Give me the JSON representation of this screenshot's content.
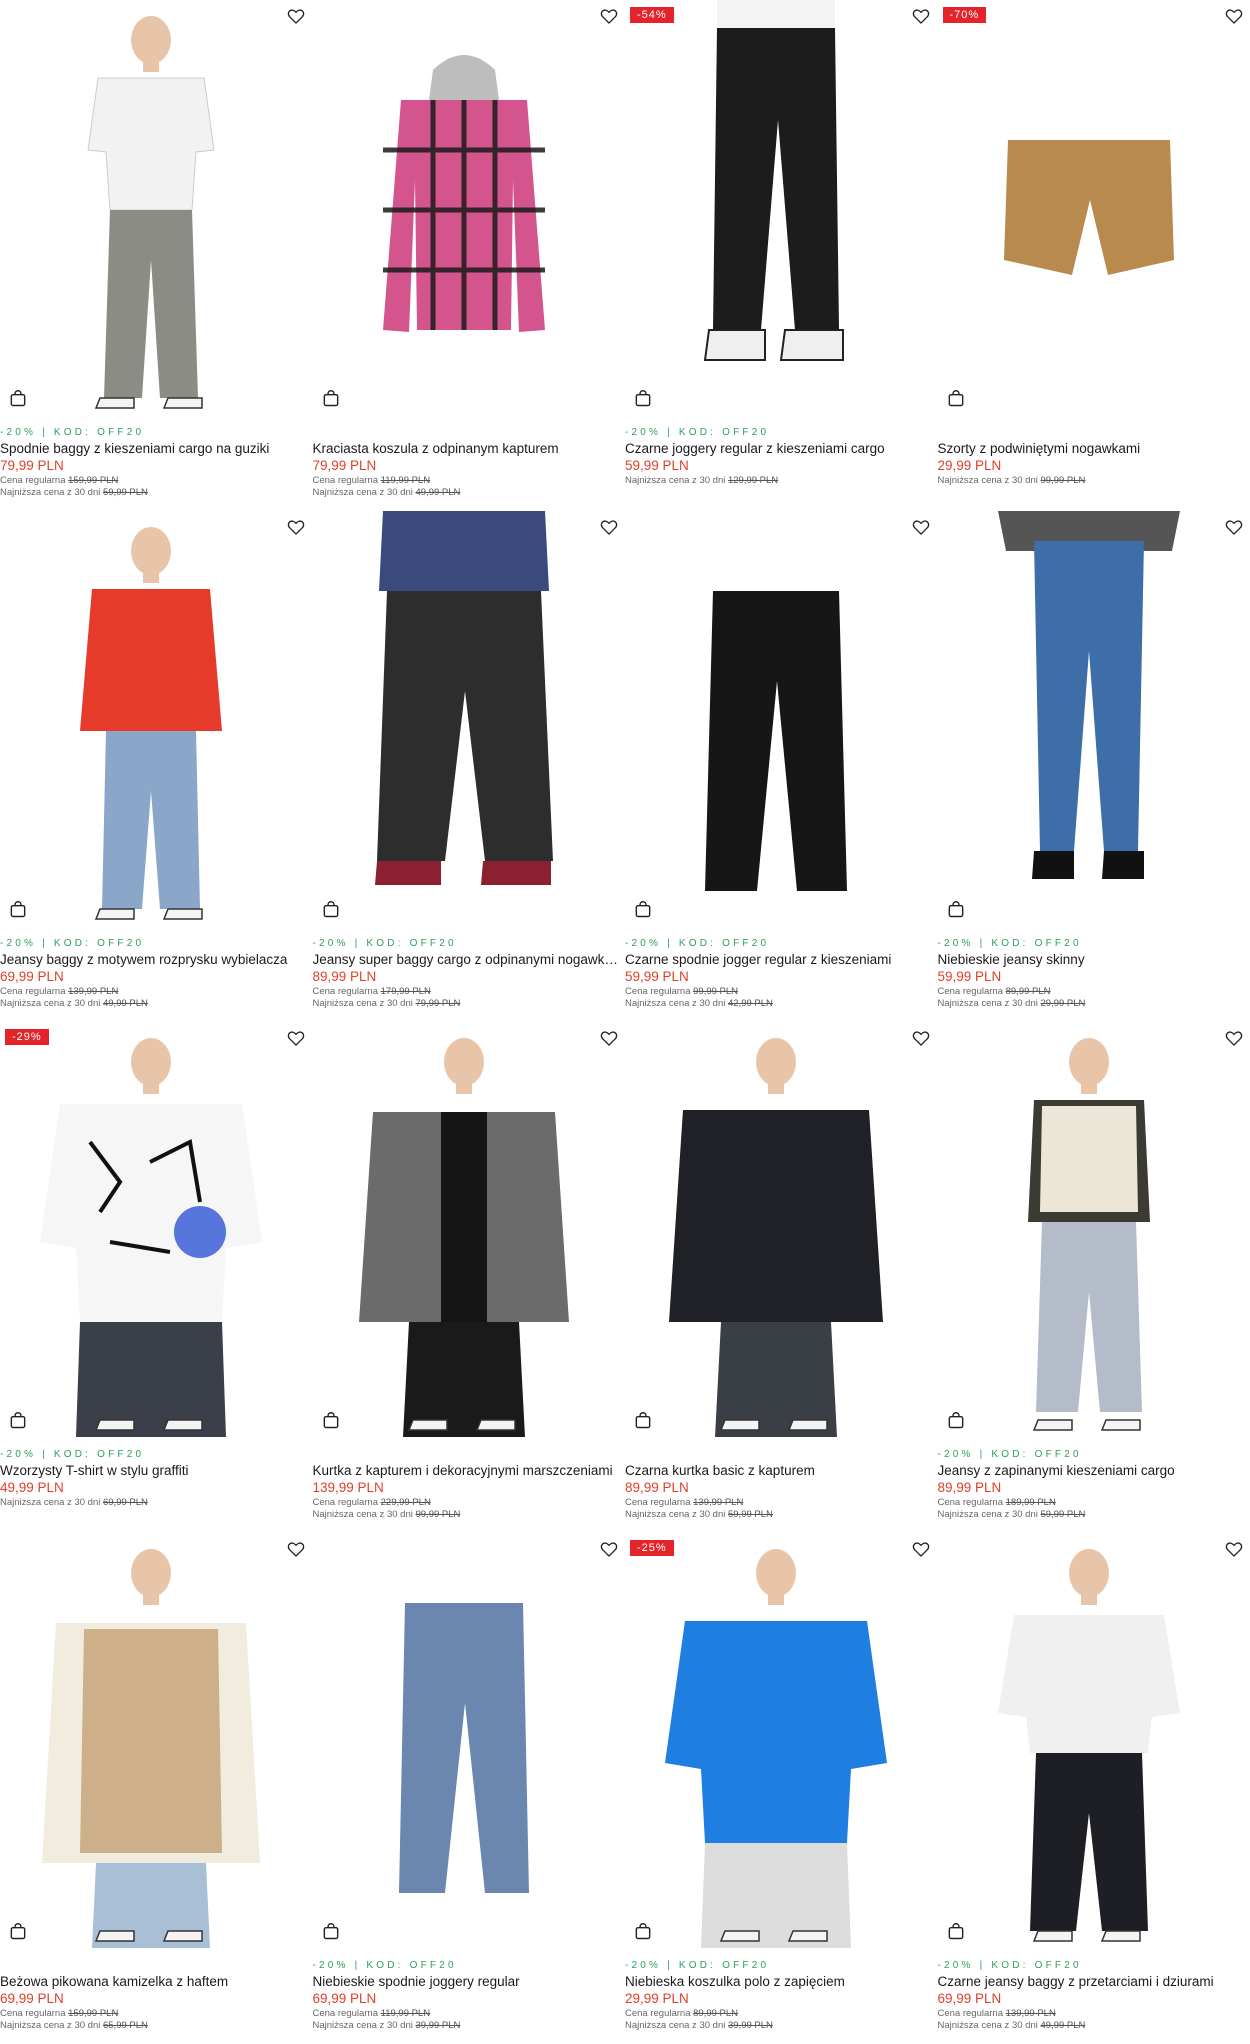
{
  "products": [
    {
      "badge": "",
      "promo": "-20% | KOD: OFF20",
      "name": "Spodnie baggy z kieszeniami cargo na guziki",
      "price": "79,99 PLN",
      "regular_label": "Cena regularna",
      "regular_price": "159,99 PLN",
      "lowest_label": "Najniższa cena z 30 dni",
      "lowest_price": "59,99 PLN",
      "image": "model-white-shirt-grey-cargo"
    },
    {
      "badge": "",
      "promo": "",
      "name": "Kraciasta koszula z odpinanym kapturem",
      "price": "79,99 PLN",
      "regular_label": "Cena regularna",
      "regular_price": "119,99 PLN",
      "lowest_label": "Najniższa cena z 30 dni",
      "lowest_price": "49,99 PLN",
      "image": "pink-plaid-hooded-shirt"
    },
    {
      "badge": "-54%",
      "promo": "-20% | KOD: OFF20",
      "name": "Czarne joggery regular z kieszeniami cargo",
      "price": "59,99 PLN",
      "regular_label": "",
      "regular_price": "",
      "lowest_label": "Najniższa cena z 30 dni",
      "lowest_price": "129,99 PLN",
      "image": "black-cargo-joggers"
    },
    {
      "badge": "-70%",
      "promo": "",
      "name": "Szorty z podwiniętymi nogawkami",
      "price": "29,99 PLN",
      "regular_label": "",
      "regular_price": "",
      "lowest_label": "Najniższa cena z 30 dni",
      "lowest_price": "99,99 PLN",
      "image": "tan-shorts"
    },
    {
      "badge": "",
      "promo": "-20% | KOD: OFF20",
      "name": "Jeansy baggy z motywem rozprysku wybielacza",
      "price": "69,99 PLN",
      "regular_label": "Cena regularna",
      "regular_price": "139,99 PLN",
      "lowest_label": "Najniższa cena z 30 dni",
      "lowest_price": "49,99 PLN",
      "image": "model-red-hoodie-jeans"
    },
    {
      "badge": "",
      "promo": "-20% | KOD: OFF20",
      "name": "Jeansy super baggy cargo z odpinanymi nogawkami",
      "price": "89,99 PLN",
      "regular_label": "Cena regularna",
      "regular_price": "179,99 PLN",
      "lowest_label": "Najniższa cena z 30 dni",
      "lowest_price": "79,99 PLN",
      "image": "black-baggy-cargo-jeans"
    },
    {
      "badge": "",
      "promo": "-20% | KOD: OFF20",
      "name": "Czarne spodnie jogger regular z kieszeniami",
      "price": "59,99 PLN",
      "regular_label": "Cena regularna",
      "regular_price": "99,99 PLN",
      "lowest_label": "Najniższa cena z 30 dni",
      "lowest_price": "42,99 PLN",
      "image": "black-joggers-flat"
    },
    {
      "badge": "",
      "promo": "-20% | KOD: OFF20",
      "name": "Niebieskie jeansy skinny",
      "price": "59,99 PLN",
      "regular_label": "Cena regularna",
      "regular_price": "89,99 PLN",
      "lowest_label": "Najniższa cena z 30 dni",
      "lowest_price": "29,99 PLN",
      "image": "blue-skinny-jeans"
    },
    {
      "badge": "-29%",
      "promo": "-20% | KOD: OFF20",
      "name": "Wzorzysty T-shirt w stylu graffiti",
      "price": "49,99 PLN",
      "regular_label": "",
      "regular_price": "",
      "lowest_label": "Najniższa cena z 30 dni",
      "lowest_price": "69,99 PLN",
      "image": "model-graffiti-tshirt"
    },
    {
      "badge": "",
      "promo": "",
      "name": "Kurtka z kapturem i dekoracyjnymi marszczeniami",
      "price": "139,99 PLN",
      "regular_label": "Cena regularna",
      "regular_price": "229,99 PLN",
      "lowest_label": "Najniższa cena z 30 dni",
      "lowest_price": "99,99 PLN",
      "image": "model-grey-hooded-jacket"
    },
    {
      "badge": "",
      "promo": "",
      "name": "Czarna kurtka basic z kapturem",
      "price": "89,99 PLN",
      "regular_label": "Cena regularna",
      "regular_price": "139,99 PLN",
      "lowest_label": "Najniższa cena z 30 dni",
      "lowest_price": "59,99 PLN",
      "image": "model-black-jacket"
    },
    {
      "badge": "",
      "promo": "-20% | KOD: OFF20",
      "name": "Jeansy z zapinanymi kieszeniami cargo",
      "price": "89,99 PLN",
      "regular_label": "Cena regularna",
      "regular_price": "189,99 PLN",
      "lowest_label": "Najniższa cena z 30 dni",
      "lowest_price": "59,99 PLN",
      "image": "model-vest-cargo-jeans"
    },
    {
      "badge": "",
      "promo": "",
      "name": "Beżowa pikowana kamizelka z haftem",
      "price": "69,99 PLN",
      "regular_label": "Cena regularna",
      "regular_price": "159,99 PLN",
      "lowest_label": "Najniższa cena z 30 dni",
      "lowest_price": "65,99 PLN",
      "image": "model-beige-puffer-vest"
    },
    {
      "badge": "",
      "promo": "-20% | KOD: OFF20",
      "name": "Niebieskie spodnie joggery regular",
      "price": "69,99 PLN",
      "regular_label": "Cena regularna",
      "regular_price": "119,99 PLN",
      "lowest_label": "Najniższa cena z 30 dni",
      "lowest_price": "39,99 PLN",
      "image": "blue-denim-joggers"
    },
    {
      "badge": "-25%",
      "promo": "-20% | KOD: OFF20",
      "name": "Niebieska koszulka polo z zapięciem",
      "price": "29,99 PLN",
      "regular_label": "Cena regularna",
      "regular_price": "89,99 PLN",
      "lowest_label": "Najniższa cena z 30 dni",
      "lowest_price": "39,99 PLN",
      "image": "model-blue-polo"
    },
    {
      "badge": "",
      "promo": "-20% | KOD: OFF20",
      "name": "Czarne jeansy baggy z przetarciami i dziurami",
      "price": "69,99 PLN",
      "regular_label": "Cena regularna",
      "regular_price": "139,99 PLN",
      "lowest_label": "Najniższa cena z 30 dni",
      "lowest_price": "49,99 PLN",
      "image": "model-white-tee-black-jeans"
    }
  ],
  "colors": {
    "sale": "#e0402a",
    "promo": "#2e9e5b",
    "badge": "#e3242b"
  },
  "icons": {
    "wishlist": "heart-icon",
    "cart": "shopping-bag-icon"
  }
}
